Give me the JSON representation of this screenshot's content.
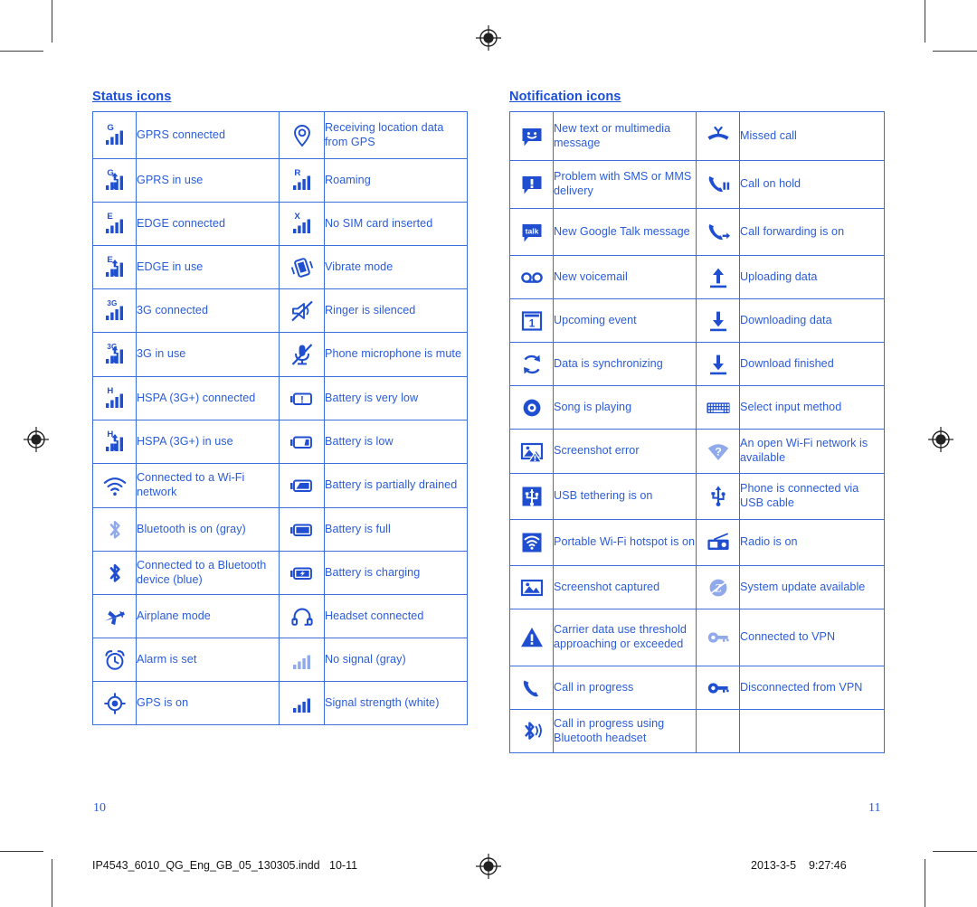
{
  "document": {
    "left_page": {
      "section_title": "Status icons",
      "page_number": "10"
    },
    "right_page": {
      "section_title": "Notification icons",
      "page_number": "11"
    }
  },
  "colors": {
    "text_blue": "#2a5cd8",
    "border_blue": "#3b6fe0",
    "title_blue": "#1a4fd6",
    "icon_blue_dark": "#1f4fd0",
    "icon_blue_light": "#8fa9ea",
    "footer_black": "#161616",
    "page_white": "#ffffff"
  },
  "status_icons": {
    "title": "Status icons",
    "rows": [
      {
        "left": {
          "icon": "signal-bars-gprs-connected-icon",
          "label": "GPRS connected"
        },
        "right": {
          "icon": "gps-location-pin-icon",
          "label": "Receiving location data from GPS"
        }
      },
      {
        "left": {
          "icon": "signal-bars-gprs-in-use-icon",
          "label": "GPRS in use"
        },
        "right": {
          "icon": "signal-bars-roaming-icon",
          "label": "Roaming"
        }
      },
      {
        "left": {
          "icon": "signal-bars-edge-connected-icon",
          "label": "EDGE connected"
        },
        "right": {
          "icon": "signal-bars-no-sim-icon",
          "label": "No SIM card inserted"
        }
      },
      {
        "left": {
          "icon": "signal-bars-edge-in-use-icon",
          "label": "EDGE in use"
        },
        "right": {
          "icon": "vibrate-mode-icon",
          "label": "Vibrate mode"
        }
      },
      {
        "left": {
          "icon": "signal-bars-3g-connected-icon",
          "label": "3G connected"
        },
        "right": {
          "icon": "ringer-silenced-icon",
          "label": "Ringer is silenced"
        }
      },
      {
        "left": {
          "icon": "signal-bars-3g-in-use-icon",
          "label": "3G in use"
        },
        "right": {
          "icon": "microphone-mute-icon",
          "label": "Phone microphone is mute"
        }
      },
      {
        "left": {
          "icon": "signal-bars-hspa-connected-icon",
          "label": "HSPA (3G+) connected"
        },
        "right": {
          "icon": "battery-very-low-icon",
          "label": "Battery is very low"
        }
      },
      {
        "left": {
          "icon": "signal-bars-hspa-in-use-icon",
          "label": "HSPA (3G+) in use"
        },
        "right": {
          "icon": "battery-low-icon",
          "label": "Battery is low"
        }
      },
      {
        "left": {
          "icon": "wifi-connected-icon",
          "label": "Connected to a Wi-Fi network"
        },
        "right": {
          "icon": "battery-partially-drained-icon",
          "label": "Battery is partially drained"
        }
      },
      {
        "left": {
          "icon": "bluetooth-on-gray-icon",
          "label": "Bluetooth is on (gray)"
        },
        "right": {
          "icon": "battery-full-icon",
          "label": "Battery is full"
        }
      },
      {
        "left": {
          "icon": "bluetooth-connected-blue-icon",
          "label": "Connected to a Bluetooth device (blue)"
        },
        "right": {
          "icon": "battery-charging-icon",
          "label": "Battery is charging"
        }
      },
      {
        "left": {
          "icon": "airplane-mode-icon",
          "label": "Airplane mode"
        },
        "right": {
          "icon": "headset-connected-icon",
          "label": "Headset connected"
        }
      },
      {
        "left": {
          "icon": "alarm-clock-icon",
          "label": "Alarm is set"
        },
        "right": {
          "icon": "signal-bars-no-signal-gray-icon",
          "label": "No signal (gray)"
        }
      },
      {
        "left": {
          "icon": "gps-on-icon",
          "label": "GPS is on"
        },
        "right": {
          "icon": "signal-bars-signal-strength-white-icon",
          "label": "Signal strength (white)"
        }
      }
    ]
  },
  "notification_icons": {
    "title": "Notification icons",
    "rows": [
      {
        "left": {
          "icon": "new-message-smiley-icon",
          "label": "New text or multimedia message"
        },
        "right": {
          "icon": "missed-call-icon",
          "label": "Missed call"
        }
      },
      {
        "left": {
          "icon": "message-problem-icon",
          "label": "Problem with SMS or MMS delivery"
        },
        "right": {
          "icon": "call-on-hold-icon",
          "label": "Call on hold"
        }
      },
      {
        "left": {
          "icon": "google-talk-icon",
          "label": "New Google Talk message",
          "glyph_text": "talk"
        },
        "right": {
          "icon": "call-forwarding-icon",
          "label": "Call forwarding is on"
        }
      },
      {
        "left": {
          "icon": "voicemail-icon",
          "label": "New voicemail"
        },
        "right": {
          "icon": "upload-data-icon",
          "label": "Uploading data"
        }
      },
      {
        "left": {
          "icon": "upcoming-event-calendar-icon",
          "label": "Upcoming event",
          "glyph_text": "1"
        },
        "right": {
          "icon": "download-data-icon",
          "label": "Downloading data"
        }
      },
      {
        "left": {
          "icon": "data-sync-icon",
          "label": "Data is synchronizing"
        },
        "right": {
          "icon": "download-finished-icon",
          "label": "Download finished"
        }
      },
      {
        "left": {
          "icon": "song-playing-icon",
          "label": "Song is playing"
        },
        "right": {
          "icon": "select-input-method-keyboard-icon",
          "label": "Select input method"
        }
      },
      {
        "left": {
          "icon": "screenshot-error-icon",
          "label": "Screenshot error"
        },
        "right": {
          "icon": "open-wifi-available-icon",
          "label": "An open Wi-Fi network is available"
        }
      },
      {
        "left": {
          "icon": "usb-tethering-icon",
          "label": "USB tethering is on"
        },
        "right": {
          "icon": "usb-cable-connected-icon",
          "label": "Phone is connected via USB cable"
        }
      },
      {
        "left": {
          "icon": "portable-wifi-hotspot-icon",
          "label": "Portable Wi-Fi hotspot is on"
        },
        "right": {
          "icon": "radio-on-icon",
          "label": "Radio is on"
        }
      },
      {
        "left": {
          "icon": "screenshot-captured-icon",
          "label": "Screenshot captured"
        },
        "right": {
          "icon": "system-update-icon",
          "label": "System update available"
        }
      },
      {
        "left": {
          "icon": "carrier-data-warning-icon",
          "label": "Carrier data use threshold approaching or exceeded"
        },
        "right": {
          "icon": "vpn-connected-key-icon",
          "label": "Connected to VPN"
        }
      },
      {
        "left": {
          "icon": "call-in-progress-icon",
          "label": "Call in progress"
        },
        "right": {
          "icon": "vpn-disconnected-key-icon",
          "label": "Disconnected from VPN"
        }
      },
      {
        "left": {
          "icon": "call-bluetooth-headset-icon",
          "label": "Call in progress using Bluetooth headset"
        },
        "right": {
          "icon": "",
          "label": ""
        }
      }
    ]
  },
  "footer": {
    "filename": "IP4543_6010_QG_Eng_GB_05_130305.indd",
    "page_range": "10-11",
    "date": "2013-3-5",
    "time": "9:27:46"
  }
}
